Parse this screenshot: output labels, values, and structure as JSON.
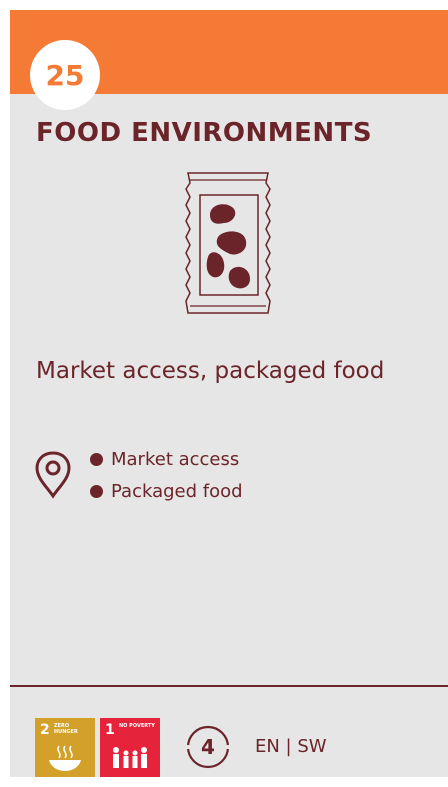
{
  "card": {
    "number": "25",
    "title": "FOOD ENVIRONMENTS",
    "subtitle": "Market access, packaged food",
    "bullets": [
      "Market access",
      "Packaged food"
    ],
    "sdgs": [
      {
        "number": "2",
        "label": "ZERO HUNGER",
        "color": "#d3a029",
        "icon": "bowl-icon"
      },
      {
        "number": "1",
        "label": "NO POVERTY",
        "color": "#e5243b",
        "icon": "family-icon"
      }
    ],
    "level": "4",
    "languages": "EN | SW"
  },
  "colors": {
    "accent": "#f47a36",
    "text": "#6b2429",
    "background": "#e6e6e6"
  },
  "icons": {
    "main": "packaged-beans-icon",
    "location": "location-pin-icon"
  }
}
